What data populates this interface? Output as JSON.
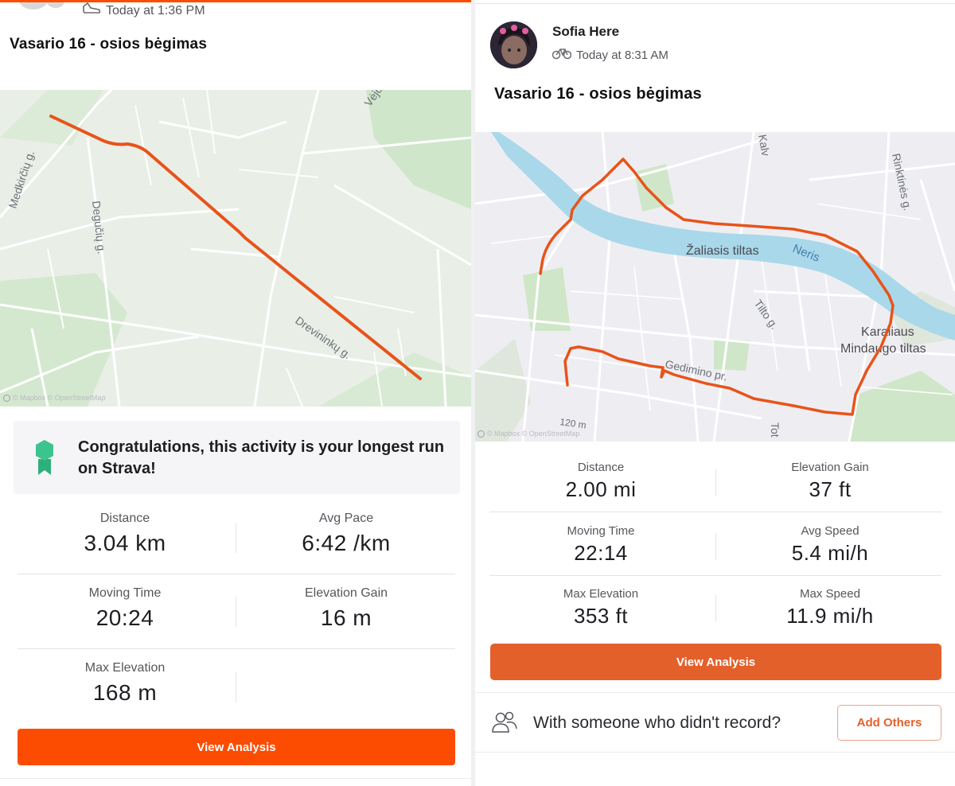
{
  "left": {
    "timestamp": "Today at 1:36 PM",
    "title": "Vasario 16 - osios bėgimas",
    "map": {
      "streets": [
        "Medkirčių g.",
        "Degučių g.",
        "Drevininkų g.",
        "Vėjo"
      ],
      "attribution": "© Mapbox © OpenStreetMap"
    },
    "congrats": "Congratulations, this activity is your longest run on Strava!",
    "stats": [
      {
        "label": "Distance",
        "value": "3.04 km"
      },
      {
        "label": "Avg Pace",
        "value": "6:42 /km"
      },
      {
        "label": "Moving Time",
        "value": "20:24"
      },
      {
        "label": "Elevation Gain",
        "value": "16 m"
      },
      {
        "label": "Max Elevation",
        "value": "168 m"
      }
    ],
    "button": "View Analysis"
  },
  "right": {
    "athlete": "Sofia Here",
    "timestamp": "Today at 8:31 AM",
    "title": "Vasario 16 - osios bėgimas",
    "map": {
      "labels": [
        "Žaliasis tiltas",
        "Neris",
        "Tilto g.",
        "Karaliaus",
        "Mindaugo tiltas",
        "Gedimino pr.",
        "Rinktinės g.",
        "Kalv",
        "Tot",
        "120 m"
      ],
      "attribution": "© Mapbox © OpenStreetMap"
    },
    "stats": [
      {
        "label": "Distance",
        "value": "2.00 mi"
      },
      {
        "label": "Elevation Gain",
        "value": "37 ft"
      },
      {
        "label": "Moving Time",
        "value": "22:14"
      },
      {
        "label": "Avg Speed",
        "value": "5.4 mi/h"
      },
      {
        "label": "Max Elevation",
        "value": "353 ft"
      },
      {
        "label": "Max Speed",
        "value": "11.9 mi/h"
      }
    ],
    "button": "View Analysis",
    "with_someone": "With someone who didn't record?",
    "add_others": "Add Others"
  },
  "colors": {
    "strava_orange": "#fc4c02",
    "route": "#e8531a",
    "river": "#a9d8ea",
    "park": "#c8e6c4",
    "badge": "#2bb07c"
  },
  "icons": [
    "sneaker-icon",
    "bike-icon",
    "medal-badge-icon",
    "mapbox-logo-icon",
    "people-icon"
  ]
}
